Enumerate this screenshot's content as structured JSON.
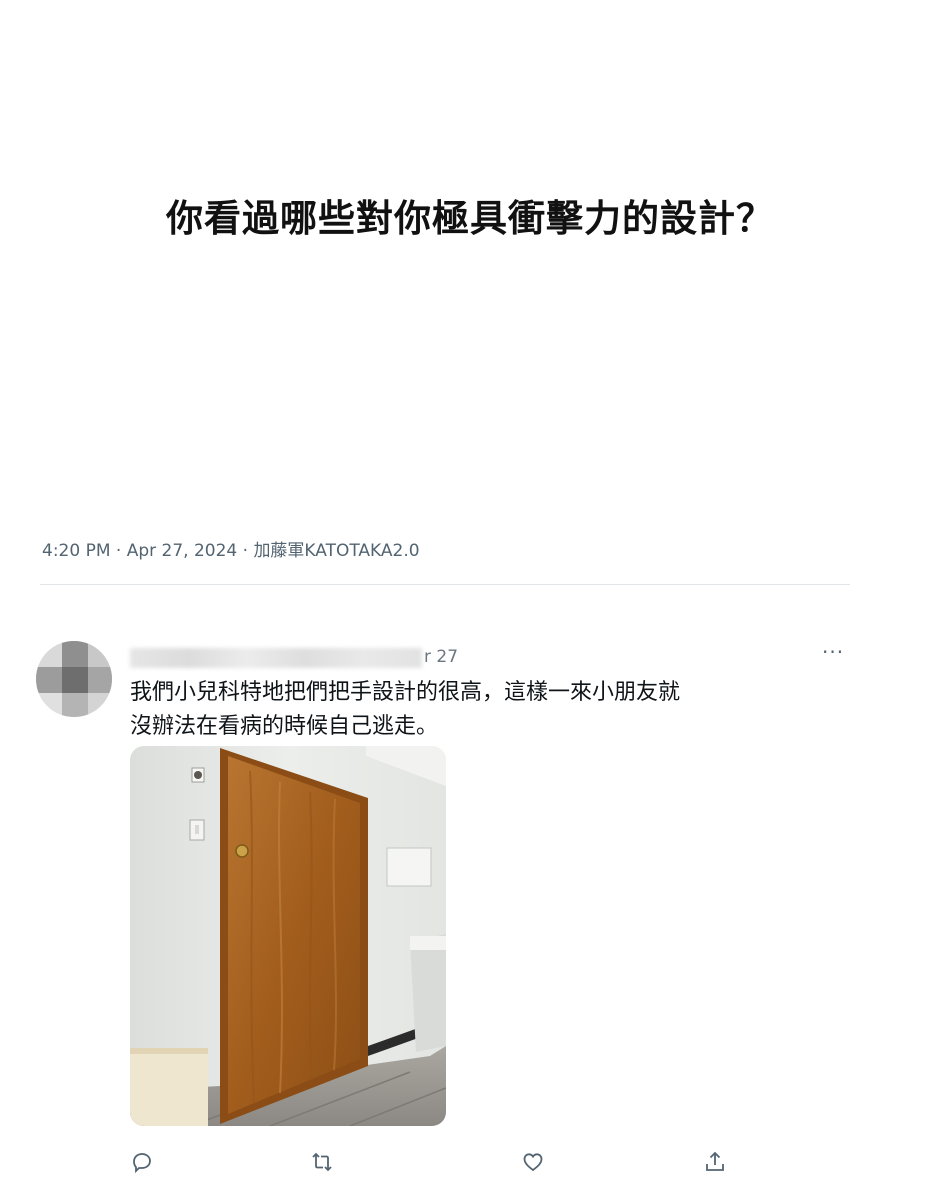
{
  "post": {
    "headline": "你看過哪些對你極具衝擊力的設計？",
    "meta": "4:20 PM · Apr 27, 2024 · 加藤軍KATOTAKA2.0"
  },
  "reply": {
    "date_fragment": "r 27",
    "more_label": "···",
    "text_line1": "我們小兒科特地把們把手設計的很高，這樣一來小朋友就",
    "text_line2": "沒辦法在看病的時候自己逃走。",
    "image_icon": "door-photo"
  },
  "actions": {
    "reply_icon": "reply-icon",
    "retweet_icon": "retweet-icon",
    "like_icon": "like-icon",
    "share_icon": "share-icon"
  },
  "colors": {
    "meta_text": "#536471",
    "door": "#a8621f",
    "wall": "#e8ebe8",
    "floor": "#9a9691"
  }
}
